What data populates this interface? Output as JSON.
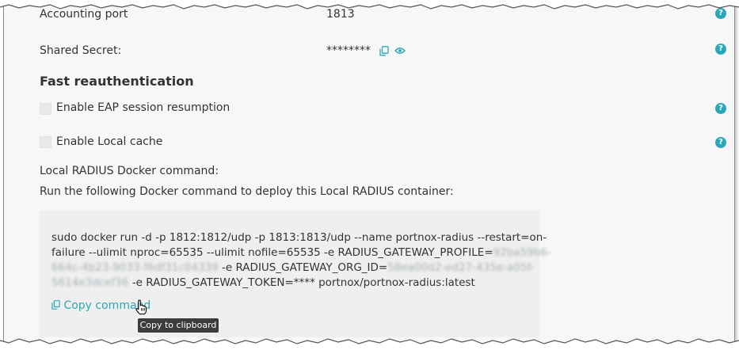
{
  "accounting_port": {
    "label": "Accounting port",
    "value": "1813"
  },
  "shared_secret": {
    "label": "Shared Secret:",
    "value": "********"
  },
  "fast_reauth": {
    "title": "Fast reauthentication",
    "eap_resumption_label": "Enable EAP session resumption",
    "local_cache_label": "Enable Local cache"
  },
  "docker": {
    "title": "Local RADIUS Docker command:",
    "instruction": "Run the following Docker command to deploy this Local RADIUS container:",
    "line1": "sudo docker run -d -p 1812:1812/udp -p 1813:1813/udp --name portnox-radius --restart=on-",
    "line2_text": "failure --ulimit nproc=65535 --ulimit nofile=65535 -e RADIUS_GATEWAY_PROFILE=",
    "line2_blur": "92ba59b6-",
    "line3_blur": "664c-4b23-9033-f6df31c04339",
    "line3_text": " -e RADIUS_GATEWAY_ORG_ID=",
    "line3_blur2": "58ea00d2-ed27-435e-a05f-",
    "line4_blur": "5614e3dcef36",
    "line4_text": " -e RADIUS_GATEWAY_TOKEN=**** portnox/portnox-radius:latest",
    "copy_label": "Copy command",
    "tooltip": "Copy to clipboard"
  },
  "help_symbol": "?",
  "colors": {
    "accent": "#2ba8b8",
    "panel_bg": "#f7f7f7",
    "code_bg": "#efefef"
  },
  "icons": [
    "help-icon",
    "copy-icon",
    "eye-icon",
    "hand-cursor-icon"
  ]
}
